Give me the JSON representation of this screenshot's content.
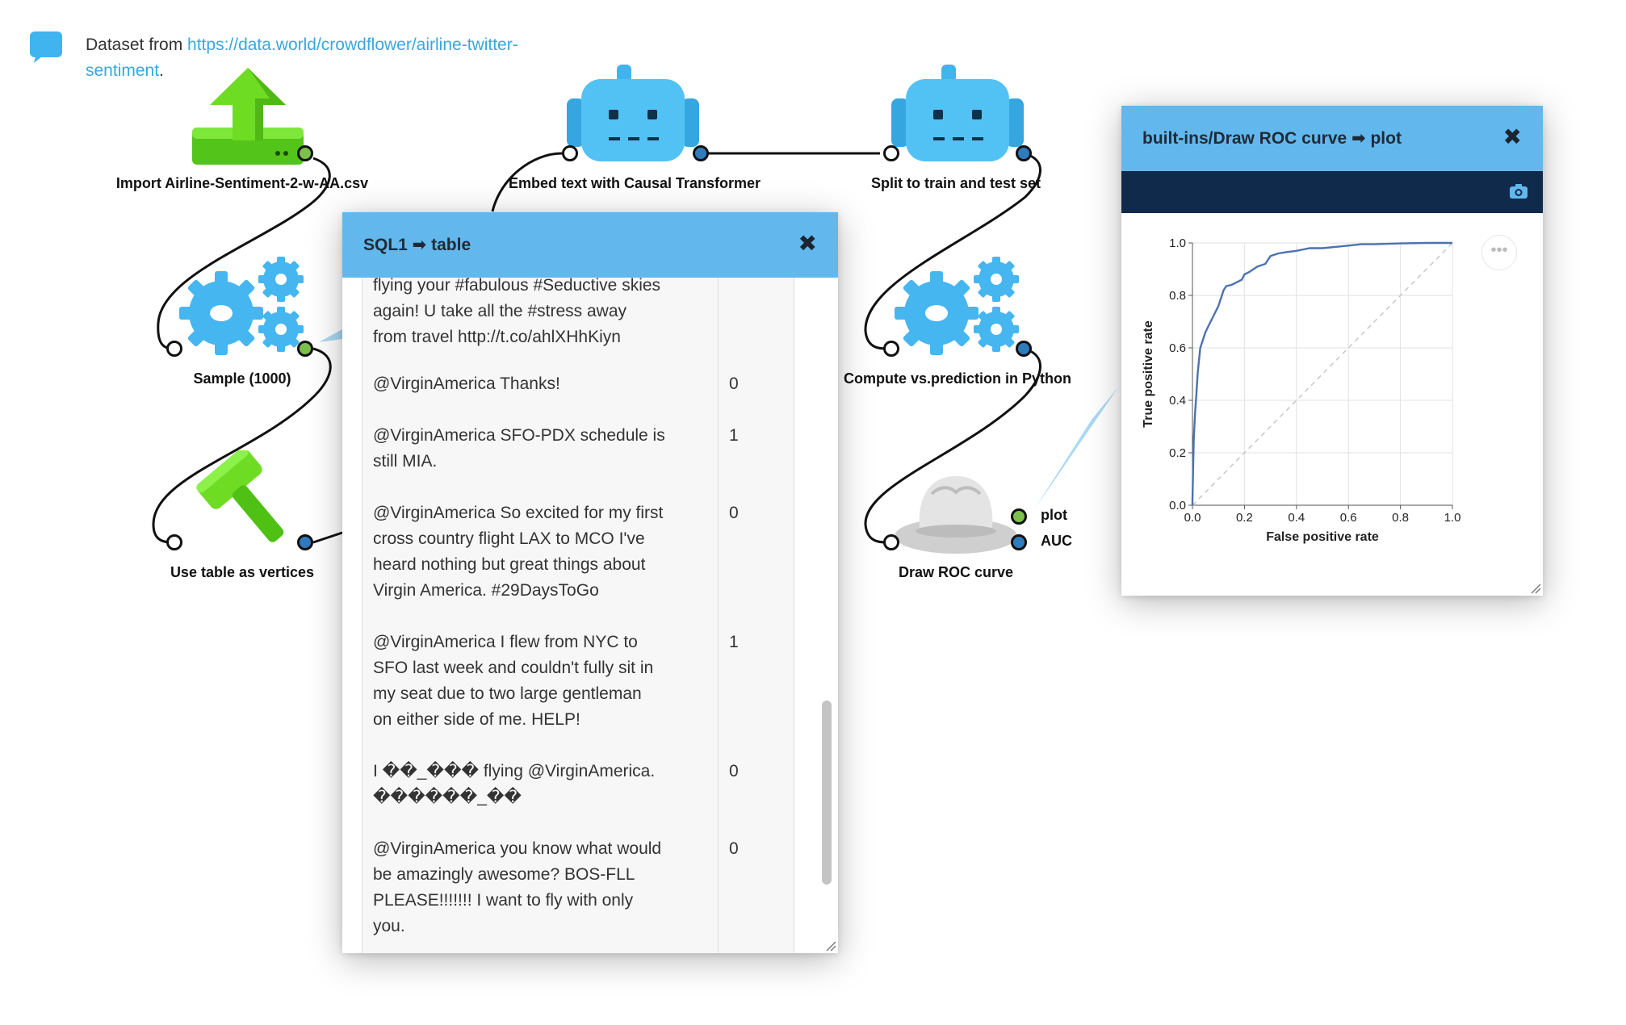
{
  "comment": {
    "prefix": "Dataset from ",
    "link": "https://data.world/crowdflower/airline-twitter-sentiment",
    "link_line1": "https://data.world/crowdflower/airline-twitter-",
    "link_line2": "sentiment",
    "suffix": "."
  },
  "boxes": {
    "import": "Import Airline-Sentiment-2-w-AA.csv",
    "embed": "Embed text with Causal Transformer",
    "split": "Split to train and test set",
    "sample": "Sample (1000)",
    "compute": "Compute vs.prediction in Python",
    "vertices": "Use table as vertices",
    "roc": "Draw ROC curve"
  },
  "ports": {
    "plot": "plot",
    "auc": "AUC"
  },
  "sql_popup": {
    "title": "SQL1 ➡ table",
    "close": "✖",
    "rows": [
      {
        "lines": [
          "flying your #fabulous #Seductive skies",
          "again! U take all the #stress away",
          "from travel http://t.co/ahlXHhKiyn"
        ],
        "value": ""
      },
      {
        "lines": [
          "@VirginAmerica Thanks!"
        ],
        "value": "0"
      },
      {
        "lines": [
          "@VirginAmerica SFO-PDX schedule is",
          "still MIA."
        ],
        "value": "1"
      },
      {
        "lines": [
          "@VirginAmerica So excited for my first",
          "cross country flight LAX to MCO I've",
          "heard nothing but great things about",
          "Virgin America. #29DaysToGo"
        ],
        "value": "0"
      },
      {
        "lines": [
          "@VirginAmerica I flew from NYC to",
          "SFO last week and couldn't fully sit in",
          "my seat due to two large gentleman",
          "on either side of me. HELP!"
        ],
        "value": "1"
      },
      {
        "lines": [
          "I ��_��� flying @VirginAmerica.",
          "������_��"
        ],
        "value": "0"
      },
      {
        "lines": [
          "@VirginAmerica you know what would",
          "be amazingly awesome? BOS-FLL",
          "PLEASE!!!!!!! I want to fly with only",
          "you."
        ],
        "value": "0"
      }
    ]
  },
  "roc_popup": {
    "title": "built-ins/Draw ROC curve ➡ plot",
    "close": "✖",
    "more": "•••"
  },
  "colors": {
    "header": "#62b8ec",
    "toolbar": "#0f2a4a",
    "roc_line": "#4c72b0",
    "port_green": "#7cc04b",
    "port_blue": "#2e7bbd",
    "link": "#39a7de"
  },
  "chart_data": {
    "type": "line",
    "title": "",
    "xlabel": "False positive rate",
    "ylabel": "True positive rate",
    "xlim": [
      0,
      1
    ],
    "ylim": [
      0,
      1
    ],
    "xticks": [
      "0.0",
      "0.2",
      "0.4",
      "0.6",
      "0.8",
      "1.0"
    ],
    "yticks": [
      "0.0",
      "0.2",
      "0.4",
      "0.6",
      "0.8",
      "1.0"
    ],
    "grid": true,
    "series": [
      {
        "x": [
          0,
          0,
          0.005,
          0.01,
          0.015,
          0.02,
          0.025,
          0.03,
          0.04,
          0.05,
          0.06,
          0.07,
          0.08,
          0.09,
          0.1,
          0.11,
          0.12,
          0.13,
          0.15,
          0.17,
          0.19,
          0.2,
          0.22,
          0.25,
          0.28,
          0.3,
          0.33,
          0.36,
          0.4,
          0.45,
          0.5,
          0.55,
          0.6,
          0.65,
          0.7,
          0.8,
          0.9,
          1.0
        ],
        "y": [
          0,
          0.02,
          0.25,
          0.35,
          0.42,
          0.5,
          0.55,
          0.6,
          0.63,
          0.66,
          0.68,
          0.7,
          0.72,
          0.74,
          0.76,
          0.79,
          0.82,
          0.835,
          0.84,
          0.85,
          0.86,
          0.88,
          0.89,
          0.91,
          0.92,
          0.95,
          0.96,
          0.965,
          0.97,
          0.98,
          0.98,
          0.985,
          0.99,
          0.995,
          0.995,
          0.998,
          1.0,
          1.0
        ]
      }
    ],
    "reference_line": true
  }
}
